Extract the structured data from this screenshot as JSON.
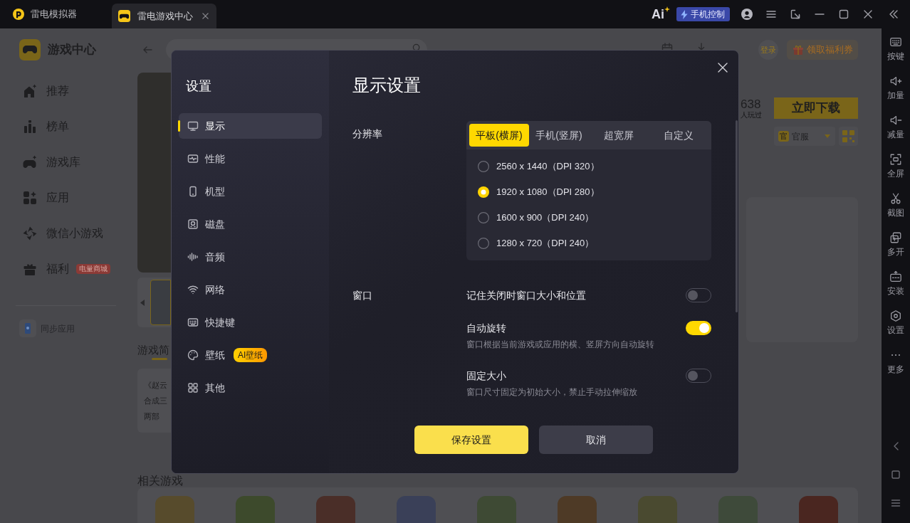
{
  "title_bar": {
    "app_name": "雷电模拟器",
    "tabs": [
      {
        "label": "雷电游戏中心",
        "selected": true
      }
    ],
    "ai_label": "Ai",
    "phone_control": "手机控制"
  },
  "side_toolbar": {
    "tools": [
      "按键",
      "加量",
      "减量",
      "全屏",
      "截图",
      "多开",
      "安装",
      "设置",
      "更多"
    ]
  },
  "game_center": {
    "brand": "游戏中心",
    "nav": [
      {
        "label": "推荐"
      },
      {
        "label": "榜单"
      },
      {
        "label": "游戏库"
      },
      {
        "label": "应用"
      },
      {
        "label": "微信小游戏"
      },
      {
        "label": "福利",
        "badge": "电量商城"
      }
    ],
    "sync_app": "同步应用"
  },
  "header": {
    "login": "登录",
    "coupon_button": "领取福利券"
  },
  "game_page": {
    "section_title": "游戏简",
    "description_lines": [
      "《赵云",
      "合成三",
      "两部"
    ],
    "play_count": "638",
    "play_count_caption": "人玩过",
    "download_button": "立即下载",
    "server_badge": "官",
    "server_select": "官服",
    "related_title": "相关游戏"
  },
  "settings_dialog": {
    "title": "设置",
    "menu": [
      {
        "label": "显示",
        "selected": true
      },
      {
        "label": "性能",
        "selected": false
      },
      {
        "label": "机型",
        "selected": false
      },
      {
        "label": "磁盘",
        "selected": false
      },
      {
        "label": "音频",
        "selected": false
      },
      {
        "label": "网络",
        "selected": false
      },
      {
        "label": "快捷键",
        "selected": false
      },
      {
        "label": "壁纸",
        "selected": false,
        "tag": "AI壁纸"
      },
      {
        "label": "其他",
        "selected": false
      }
    ],
    "heading": "显示设置",
    "resolution": {
      "label": "分辨率",
      "tabs": [
        {
          "label": "平板(横屏)",
          "selected": true
        },
        {
          "label": "手机(竖屏)",
          "selected": false
        },
        {
          "label": "超宽屏",
          "selected": false
        },
        {
          "label": "自定义",
          "selected": false
        }
      ],
      "options": [
        {
          "label": "2560 x 1440（DPI 320）",
          "selected": false
        },
        {
          "label": "1920 x 1080（DPI 280）",
          "selected": true
        },
        {
          "label": "1600 x 900（DPI 240）",
          "selected": false
        },
        {
          "label": "1280 x 720（DPI 240）",
          "selected": false
        }
      ]
    },
    "window": {
      "label": "窗口",
      "settings": [
        {
          "label": "记住关闭时窗口大小和位置",
          "on": false
        },
        {
          "label": "自动旋转",
          "on": true,
          "description": "窗口根据当前游戏或应用的横、竖屏方向自动旋转"
        },
        {
          "label": "固定大小",
          "on": false,
          "description": "窗口尺寸固定为初始大小，禁止手动拉伸缩放"
        }
      ]
    },
    "save_button": "保存设置",
    "cancel_button": "取消"
  }
}
